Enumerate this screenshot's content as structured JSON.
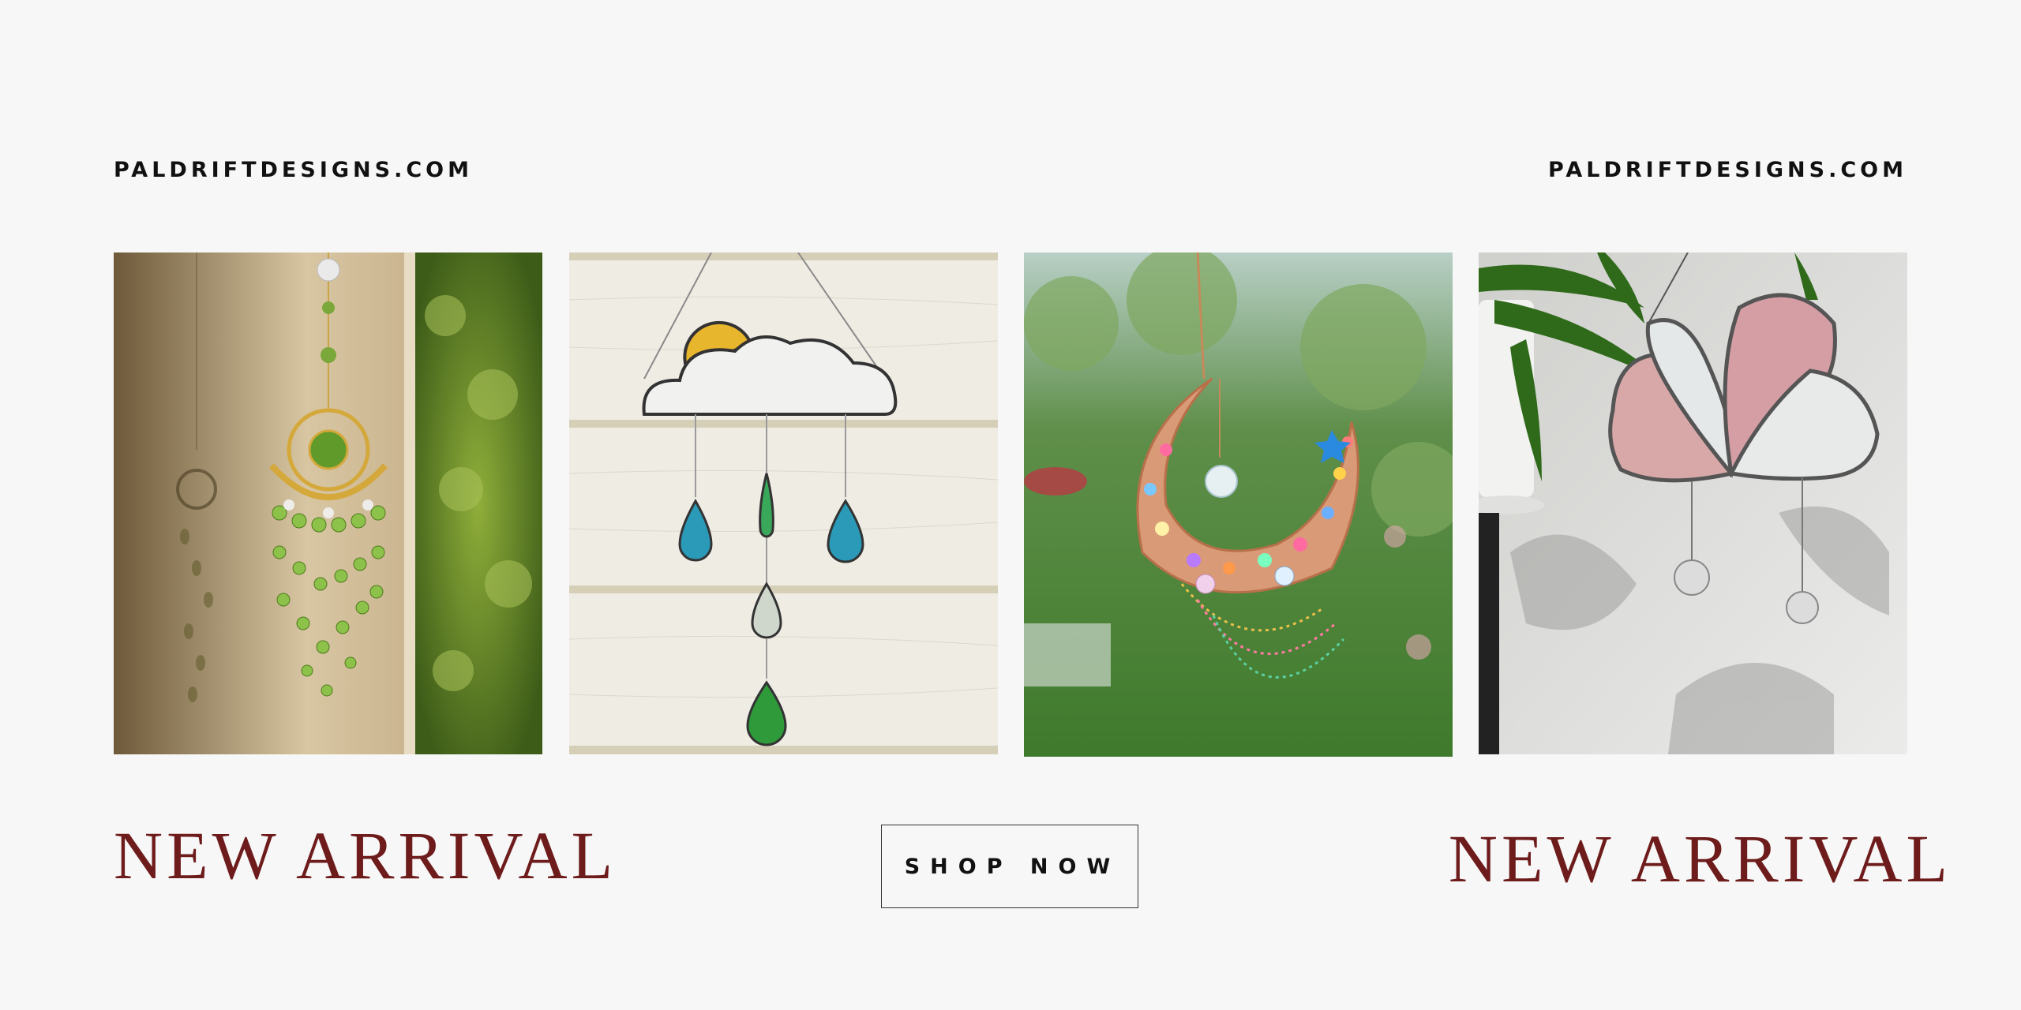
{
  "brand": {
    "left": "PALDRIFTDESIGNS.COM",
    "right": "PALDRIFTDESIGNS.COM"
  },
  "products": [
    {
      "image": "sun-moon-crystal-suncatcher"
    },
    {
      "image": "cloud-raindrop-stained-glass"
    },
    {
      "image": "crescent-moon-beaded-suncatcher"
    },
    {
      "image": "pink-flower-stained-glass"
    }
  ],
  "banner": {
    "left_heading": "NEW ARRIVAL",
    "right_heading": "NEW ARRIVAL",
    "shop_label": "SHOP NOW"
  },
  "colors": {
    "background": "#f7f7f7",
    "heading": "#6e1b1b",
    "brand_text": "#111111"
  }
}
